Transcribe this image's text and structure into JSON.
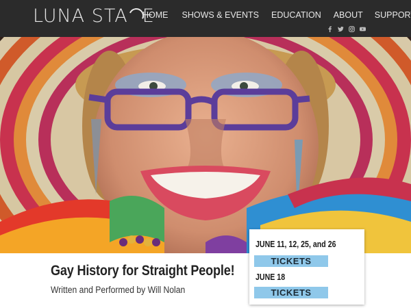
{
  "header": {
    "logo_left": "LUNA STA",
    "logo_right": "E",
    "nav": [
      {
        "label": "HOME"
      },
      {
        "label": "SHOWS & EVENTS"
      },
      {
        "label": "EDUCATION"
      },
      {
        "label": "ABOUT"
      },
      {
        "label": "SUPPORT"
      }
    ],
    "social": [
      "facebook-icon",
      "twitter-icon",
      "instagram-icon",
      "youtube-icon"
    ]
  },
  "show": {
    "title": "Gay History for Straight People!",
    "subtitle": "Written and Performed by Will Nolan"
  },
  "tickets": {
    "dates_1": "JUNE 11, 12, 25, and 26",
    "button_1": "TICKETS",
    "dates_2": "JUNE 18",
    "button_2": "TICKETS"
  },
  "colors": {
    "header_bg": "#2b2b2b",
    "ticket_button": "#8fc8ea",
    "glasses": "#5b3d9a"
  }
}
